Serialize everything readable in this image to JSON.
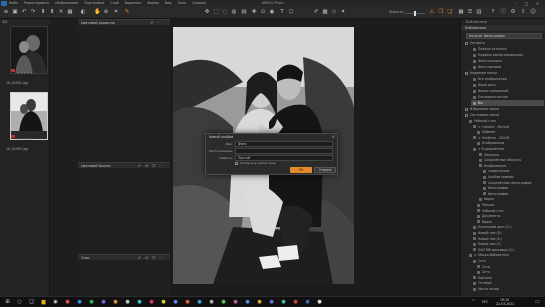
{
  "menubar": {
    "items": [
      "Файл",
      "Редактировать",
      "Изображение",
      "Подстройки",
      "Слой",
      "Выделить",
      "Формы",
      "Вид",
      "Окно",
      "Справка"
    ],
    "app_title": "Affinity Photo"
  },
  "toolbar": {
    "brightness_label": "Яркость"
  },
  "left_panel": {
    "counter": "1/2",
    "thumbnails": [
      {
        "filename": "18_04062.jpg",
        "stars": "★★★★★"
      },
      {
        "filename": "18_04063.jpg",
        "stars": "★★★★★"
      }
    ]
  },
  "mid_panel": {
    "top_header": "Цветовой редактор",
    "section_color_balance": "Цветовой баланс",
    "section_layers": "Слои"
  },
  "right_panel": {
    "tab_label": "Библиотека",
    "header": "Библиотека",
    "dropdown_value": "Каталог Фотографии",
    "group_all_photos": "Усе фото",
    "all_photos_items": [
      "Полные каталоги",
      "Недавно импортированные",
      "Фото каталога",
      "Фото корзины"
    ],
    "group_recent": "Недавние папки",
    "recent_items": [
      "Все изображения",
      "Ваша дата",
      "Ваших наложений",
      "Последняя сессия",
      "Вы"
    ],
    "group_favorites": "Избранные папки",
    "group_system": "Системные папки",
    "system_items": [
      "Рабочий стол",
      "> Creative - Portrait",
      "Кабинет",
      "> OneDrive - DOOM",
      "Изображения",
      "> В документах",
      "Загрузки",
      "Сохранённые объекты",
      "Изображения",
      "графические",
      "Альбом камеры",
      "Сохранённые фотографии",
      "Фотографии",
      "Фотографии",
      "Видео",
      "Музыка",
      "Рабочий стол",
      "Документы",
      "Видео",
      "Локальный диск (C:)",
      "Новый том (D:)",
      "Новый том (E:)",
      "Новый том (F:)",
      "DVD RW дисковод (G:)",
      "> Общая библиотека",
      "Сеть",
      "Сети",
      "Сеть",
      "Корзина",
      "Сетевой",
      "Место ночью"
    ]
  },
  "dialog": {
    "title": "Новый альбом",
    "name_label": "Имя:",
    "name_value": "Фото",
    "location_label": "Расположение:",
    "location_value": "",
    "template_label": "Шаблон:",
    "template_value": "Пустой",
    "checkbox_label": "Открыть в новом окне",
    "ok_label": "ОК",
    "cancel_label": "Отмена"
  },
  "statusbar": {
    "lang": "РУС",
    "time": "19:20",
    "date": "22.03.2022"
  },
  "colors": {
    "accent": "#e8892a",
    "badge_red": "#c53030",
    "panel_bg": "#232323"
  }
}
